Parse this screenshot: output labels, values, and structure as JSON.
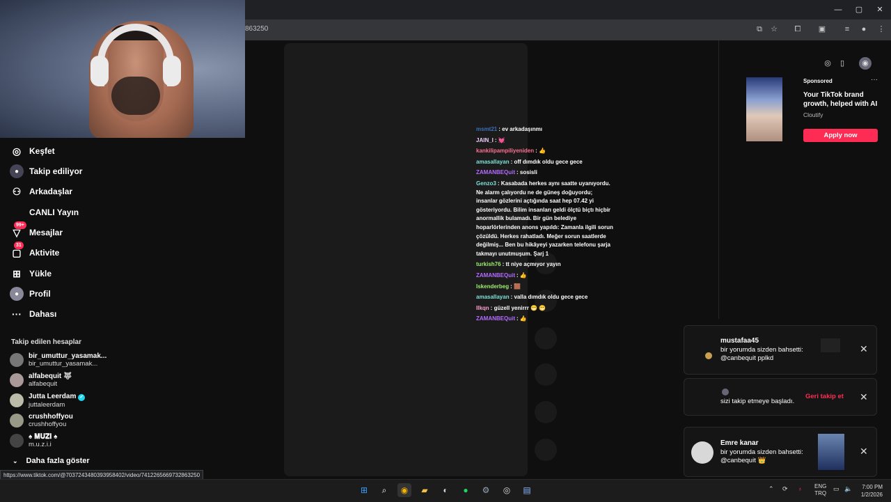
{
  "browser": {
    "url_fragment": "863250",
    "status_url": "https://www.tiktok.com/@703724348039395840​2/video/741226566973286325​0"
  },
  "nav": [
    {
      "label": "Keşfet",
      "icon": "compass-icon"
    },
    {
      "label": "Takip ediliyor",
      "icon": "avatar-icon"
    },
    {
      "label": "Arkadaşlar",
      "icon": "friends-icon"
    },
    {
      "label": "CANLI Yayın",
      "icon": "live-icon"
    },
    {
      "label": "Mesajlar",
      "icon": "messages-icon",
      "badge": "99+"
    },
    {
      "label": "Aktivite",
      "icon": "activity-icon",
      "badge": "31"
    },
    {
      "label": "Yükle",
      "icon": "upload-icon"
    },
    {
      "label": "Profil",
      "icon": "profile-icon"
    },
    {
      "label": "Dahası",
      "icon": "more-icon"
    }
  ],
  "following": {
    "title": "Takip edilen hesaplar",
    "accounts": [
      {
        "name": "bir_umuttur_yasamak...",
        "handle": "bir_umuttur_yasamak..."
      },
      {
        "name": "alfabequit 🐺",
        "handle": "alfabequit"
      },
      {
        "name": "Jutta Leerdam",
        "handle": "juttaleerdam",
        "verified": "✓"
      },
      {
        "name": "crushhoffyou",
        "handle": "crushhoffyou"
      },
      {
        "name": "♠ 𝐌𝐔𝐙𝐈 ♠",
        "handle": "m.u.z.i.i"
      }
    ],
    "show_more": "Daha fazla göster"
  },
  "chat": [
    {
      "user": "msmt21",
      "text": "ev arkadaşınmı",
      "color": "#3d6fb6"
    },
    {
      "user": "JAIN_I",
      "text": "💓",
      "color": "#f0d0ff"
    },
    {
      "user": "kankilipampiliyeniden",
      "text": "👍",
      "color": "#ff6f91"
    },
    {
      "user": "amasallayan",
      "text": "off dımdık oldu gece gece",
      "color": "#7fe3d8"
    },
    {
      "user": "ZAMANBEQuit",
      "text": "sosisli",
      "color": "#b46cff"
    },
    {
      "user": "Genzo3",
      "text": "Kasabada herkes aynı saatte uyanıyordu. Ne alarm çalıyordu ne de güneş doğuyordu; insanlar gözlerini açtığında saat hep 07.42 yi gösteriyordu. Bilim insanları geldi ölçtü biçtı hiçbir anormallik bulamadı. Bir gün belediye hoparlörlerinden anons yapıldı: Zamanla ilgili sorun çözüldü. Herkes rahatladı. Meğer sorun saatlerde değilmiş... Ben bu hikâyeyi yazarken telefonu şarja takmayı unutmuşum. Şarj 1",
      "color": "#7fe3d8"
    },
    {
      "user": "turkish76",
      "text": "tt niye açmıyor yayın",
      "color": "#9fef6f"
    },
    {
      "user": "ZAMANBEQuit",
      "text": "👍",
      "color": "#b46cff"
    },
    {
      "user": "Iskenderbeg",
      "text": "🟫",
      "color": "#9fef6f"
    },
    {
      "user": "amasallayan",
      "text": "valla dımdık oldu gece gece",
      "color": "#7fe3d8"
    },
    {
      "user": "Ilkqn",
      "text": "güzell yenirrr 😁 😁",
      "color": "#ff9fd0"
    },
    {
      "user": "ZAMANBEQuit",
      "text": "👍",
      "color": "#b46cff"
    }
  ],
  "sponsored": {
    "label": "Sponsored",
    "title": "Your TikTok brand growth, helped with AI",
    "brand": "Cloutify",
    "cta": "Apply now",
    "more": "···"
  },
  "notifications": [
    {
      "name": "mustafaa45",
      "line1": "bir yorumda sizden bahsetti:",
      "line2": "@canbequit pplkd"
    },
    {
      "line1": "sizi takip etmeye başladı.",
      "action": "Geri takip et"
    },
    {
      "name": "Emre kanar",
      "line1": "bir yorumda sizden bahsetti:",
      "line2": "@canbequit 👑"
    }
  ],
  "tray": {
    "lang1": "ENG",
    "lang2": "TRQ",
    "time": "7:00 PM",
    "date": "1/2/2026"
  },
  "colors": {
    "accent": "#fe2c55"
  }
}
